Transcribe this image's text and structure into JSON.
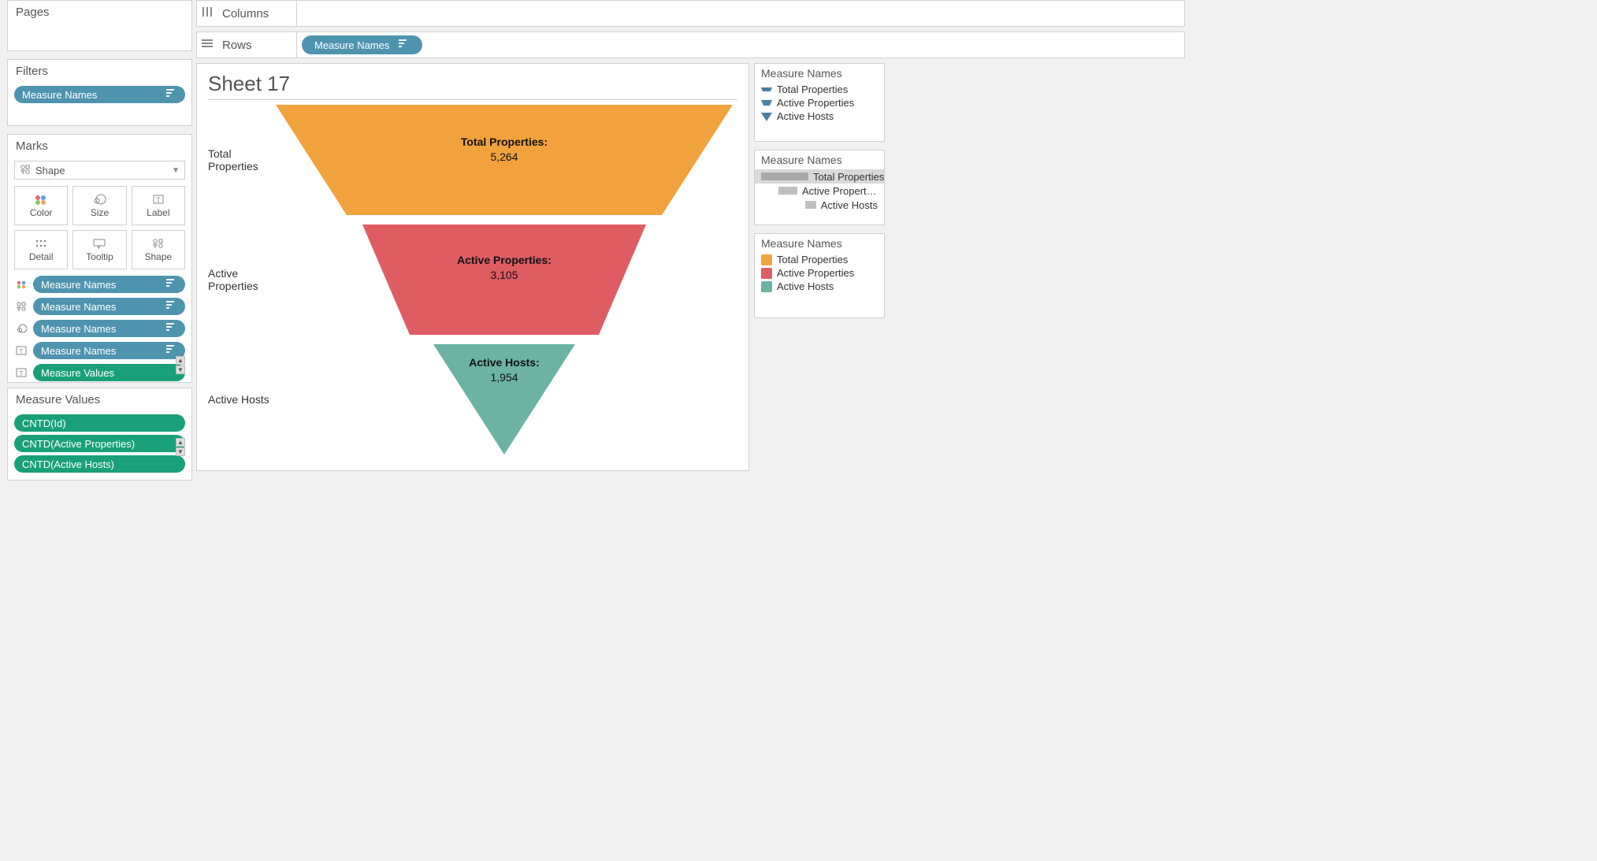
{
  "shelves": {
    "columns_label": "Columns",
    "rows_label": "Rows",
    "rows_pill": "Measure Names"
  },
  "pages": {
    "title": "Pages"
  },
  "filters": {
    "title": "Filters",
    "pill": "Measure Names"
  },
  "marks": {
    "title": "Marks",
    "type": "Shape",
    "buttons": [
      "Color",
      "Size",
      "Label",
      "Detail",
      "Tooltip",
      "Shape"
    ],
    "pills": [
      {
        "icon": "color",
        "label": "Measure Names",
        "color": "blue"
      },
      {
        "icon": "shape",
        "label": "Measure Names",
        "color": "blue"
      },
      {
        "icon": "size",
        "label": "Measure Names",
        "color": "blue"
      },
      {
        "icon": "label",
        "label": "Measure Names",
        "color": "blue"
      },
      {
        "icon": "label",
        "label": "Measure Values",
        "color": "green"
      }
    ]
  },
  "measure_values": {
    "title": "Measure Values",
    "pills": [
      "CNTD(Id)",
      "CNTD(Active Properties)",
      "CNTD(Active Hosts)"
    ]
  },
  "chart": {
    "title": "Sheet 17"
  },
  "legends": {
    "shape": {
      "title": "Measure Names",
      "items": [
        "Total Properties",
        "Active Properties",
        "Active Hosts"
      ]
    },
    "size": {
      "title": "Measure Names",
      "items": [
        {
          "label": "Total Properties",
          "selected": true,
          "width": 60
        },
        {
          "label": "Active Properties",
          "selected": false,
          "width": 24
        },
        {
          "label": "Active Hosts",
          "selected": false,
          "width": 14
        }
      ]
    },
    "color": {
      "title": "Measure Names",
      "items": [
        {
          "label": "Total Properties",
          "hex": "#f2a23c"
        },
        {
          "label": "Active Properties",
          "hex": "#df5c63"
        },
        {
          "label": "Active Hosts",
          "hex": "#6cb3a4"
        }
      ]
    }
  },
  "chart_data": {
    "type": "bar",
    "subtype": "funnel",
    "title": "Sheet 17",
    "categories": [
      "Total Properties",
      "Active Properties",
      "Active Hosts"
    ],
    "values": [
      5264,
      3105,
      1954
    ],
    "value_labels": [
      "5,264",
      "3,105",
      "1,954"
    ],
    "series_colors": [
      "#f2a23c",
      "#df5c63",
      "#6cb3a4"
    ],
    "xlabel": "",
    "ylabel": ""
  }
}
